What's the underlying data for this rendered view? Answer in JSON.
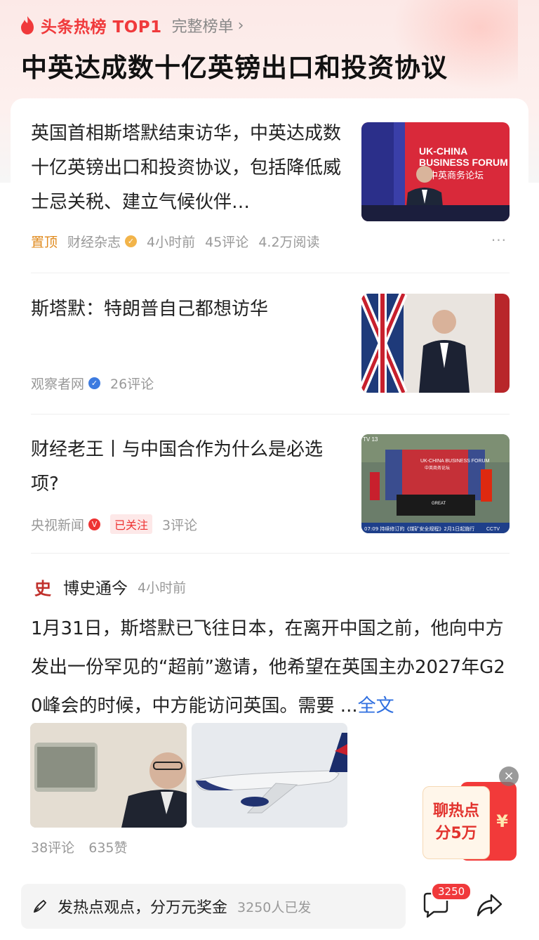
{
  "header": {
    "hot_title": "头条热榜 TOP1",
    "full_list": "完整榜单",
    "headline": "中英达成数十亿英镑出口和投资协议"
  },
  "articles": [
    {
      "title": "英国首相斯塔默结束访华，中英达成数十亿英镑出口和投资协议，包括降低威士忌关税、建立气候伙伴…",
      "pin": "置顶",
      "source": "财经杂志",
      "time": "4小时前",
      "comments": "45评论",
      "reads": "4.2万阅读",
      "more": "···",
      "image_text": [
        "UK-CHINA",
        "BUSINESS FORUM",
        "中英商务论坛"
      ]
    },
    {
      "title": "斯塔默：特朗普自己都想访华",
      "source": "观察者网",
      "comments": "26评论"
    },
    {
      "title": "财经老王丨与中国合作为什么是必选项?",
      "source": "央视新闻",
      "followed": "已关注",
      "comments": "3评论",
      "ticker": "TV 13",
      "image_caption": "UK-CHINA BUSINESS FORUM",
      "image_subcaption": "中英商务论坛",
      "image_crawl": "07:09 持续修订的《煤矿安全规程》2月1日起施行",
      "image_logo": "CCTV",
      "image_sign": "GREAT"
    }
  ],
  "post": {
    "avatar_char": "史",
    "author": "博史通今",
    "time": "4小时前",
    "body": "1月31日，斯塔默已飞往日本，在离开中国之前，他向中方发出一份罕见的“超前”邀请，他希望在英国主办2027年G20峰会的时候，中方能访问英国。需要 ...",
    "full_text": "全文",
    "comments": "38评论",
    "likes": "635赞"
  },
  "promo": {
    "line1": "聊热点",
    "line2": "分5万",
    "symbol": "¥",
    "close": "×"
  },
  "bottom": {
    "compose_text": "发热点观点，分万元奖金",
    "compose_count": "3250人已发",
    "comment_badge": "3250"
  },
  "colors": {
    "accent": "#f0393b",
    "link": "#2f6fe0",
    "pin": "#e08a1d"
  }
}
